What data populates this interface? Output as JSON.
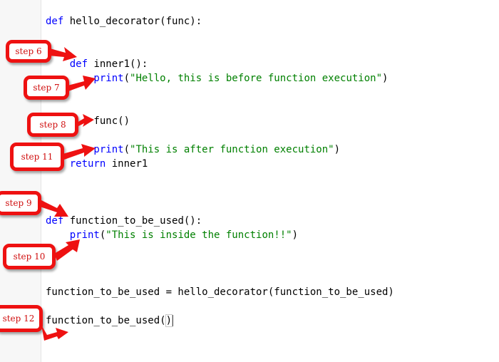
{
  "editor": {
    "lines": [
      {
        "id": "l1",
        "parts": [
          {
            "t": "def",
            "c": "kw"
          },
          {
            "t": " hello_decorator(func):",
            "c": ""
          }
        ]
      },
      {
        "id": "l2",
        "parts": [
          {
            "t": "    def",
            "c": "kw"
          },
          {
            "t": " inner1():",
            "c": ""
          }
        ]
      },
      {
        "id": "l3",
        "parts": [
          {
            "t": "        print",
            "c": "kw"
          },
          {
            "t": "(",
            "c": ""
          },
          {
            "t": "\"Hello, this is before function execution\"",
            "c": "str"
          },
          {
            "t": ")",
            "c": ""
          }
        ]
      },
      {
        "id": "l4",
        "parts": [
          {
            "t": "        func()",
            "c": ""
          }
        ]
      },
      {
        "id": "l5",
        "parts": [
          {
            "t": "        print",
            "c": "kw"
          },
          {
            "t": "(",
            "c": ""
          },
          {
            "t": "\"This is after function execution\"",
            "c": "str"
          },
          {
            "t": ")",
            "c": ""
          }
        ]
      },
      {
        "id": "l6",
        "parts": [
          {
            "t": "    return",
            "c": "kw"
          },
          {
            "t": " inner1",
            "c": ""
          }
        ]
      },
      {
        "id": "l7",
        "parts": [
          {
            "t": "def",
            "c": "kw"
          },
          {
            "t": " function_to_be_used():",
            "c": ""
          }
        ]
      },
      {
        "id": "l8",
        "parts": [
          {
            "t": "    print",
            "c": "kw"
          },
          {
            "t": "(",
            "c": ""
          },
          {
            "t": "\"This is inside the function!!\"",
            "c": "str"
          },
          {
            "t": ")",
            "c": ""
          }
        ]
      },
      {
        "id": "l9",
        "parts": [
          {
            "t": "function_to_be_used = hello_decorator(function_to_be_used)",
            "c": ""
          }
        ]
      },
      {
        "id": "l10",
        "parts": [
          {
            "t": "function_to_be_used(",
            "c": ""
          },
          {
            "t": ")",
            "c": "cursor-paren"
          }
        ]
      }
    ]
  },
  "callouts": [
    {
      "label": "step 6"
    },
    {
      "label": "step 7"
    },
    {
      "label": "step 8"
    },
    {
      "label": "step 11"
    },
    {
      "label": "step 9"
    },
    {
      "label": "step 10"
    },
    {
      "label": "step 12"
    }
  ],
  "colors": {
    "keyword": "#0000ff",
    "string": "#008000",
    "callout": "#ee1111"
  }
}
